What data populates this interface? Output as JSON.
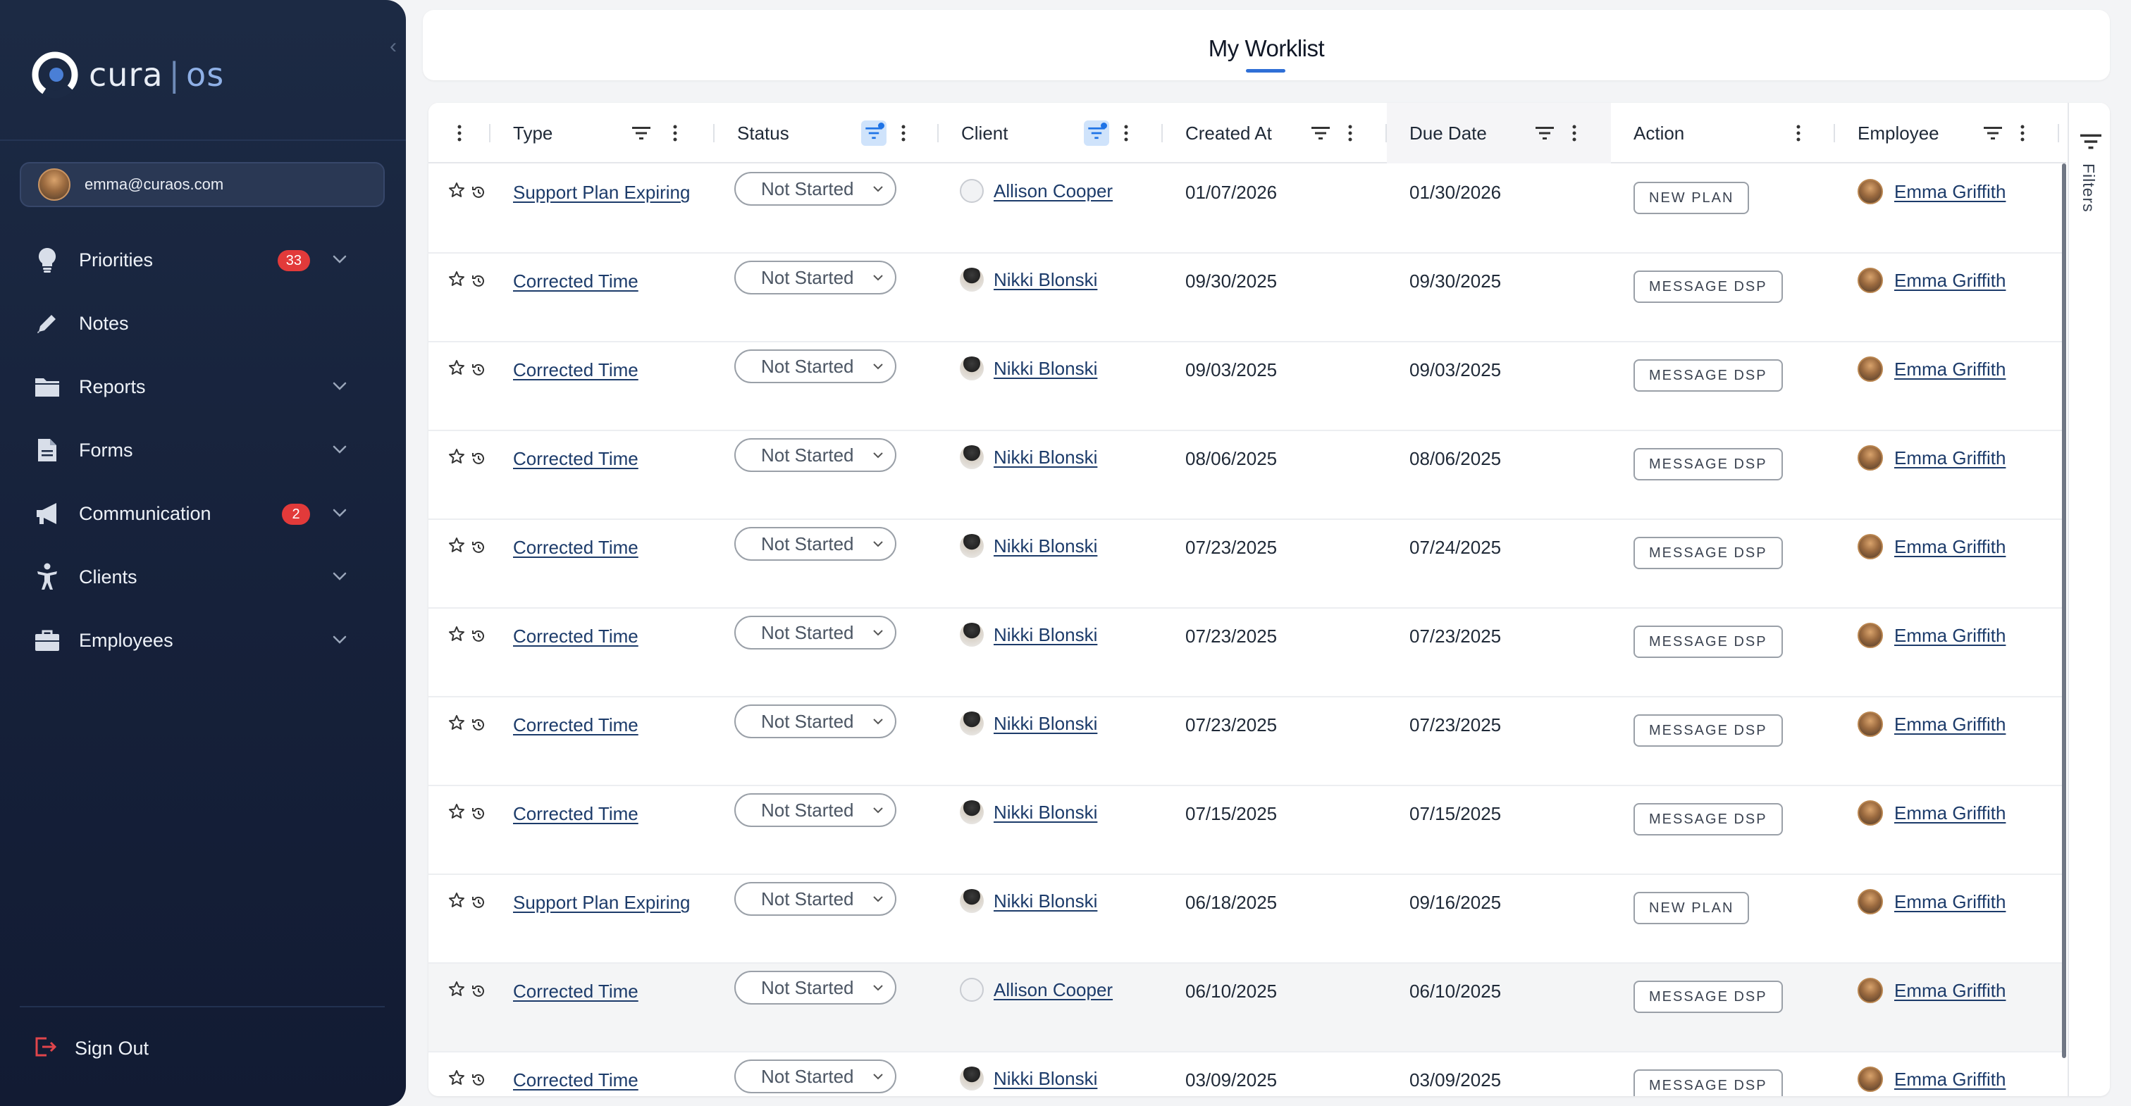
{
  "app": {
    "logo_text": "cura",
    "logo_sep": "|",
    "logo_os": "os",
    "user_email": "emma@curaos.com"
  },
  "nav": {
    "items": [
      {
        "label": "Priorities",
        "icon": "lightbulb-icon",
        "badge": "33",
        "expandable": true
      },
      {
        "label": "Notes",
        "icon": "pencil-icon",
        "badge": "",
        "expandable": false
      },
      {
        "label": "Reports",
        "icon": "folder-icon",
        "badge": "",
        "expandable": true
      },
      {
        "label": "Forms",
        "icon": "document-icon",
        "badge": "",
        "expandable": true
      },
      {
        "label": "Communication",
        "icon": "megaphone-icon",
        "badge": "2",
        "expandable": true
      },
      {
        "label": "Clients",
        "icon": "person-icon",
        "badge": "",
        "expandable": true
      },
      {
        "label": "Employees",
        "icon": "briefcase-icon",
        "badge": "",
        "expandable": true
      }
    ],
    "signout_label": "Sign Out"
  },
  "header": {
    "title": "My Worklist"
  },
  "table": {
    "columns": [
      {
        "label": "",
        "key": "select"
      },
      {
        "label": "Type",
        "filter": true,
        "filter_active": false
      },
      {
        "label": "Status",
        "filter": true,
        "filter_active": true
      },
      {
        "label": "Client",
        "filter": true,
        "filter_active": true
      },
      {
        "label": "Created At",
        "filter": true,
        "filter_active": false
      },
      {
        "label": "Due Date",
        "filter": true,
        "filter_active": false
      },
      {
        "label": "Action",
        "filter": false,
        "filter_active": false
      },
      {
        "label": "Employee",
        "filter": true,
        "filter_active": false
      }
    ],
    "rows": [
      {
        "type": "Support Plan Expiring",
        "status": "Not Started",
        "client": "Allison Cooper",
        "client_avatar": "blank",
        "created": "01/07/2026",
        "due": "01/30/2026",
        "action": "NEW PLAN",
        "employee": "Emma Griffith"
      },
      {
        "type": "Corrected Time",
        "status": "Not Started",
        "client": "Nikki Blonski",
        "client_avatar": "photo",
        "created": "09/30/2025",
        "due": "09/30/2025",
        "action": "MESSAGE DSP",
        "employee": "Emma Griffith"
      },
      {
        "type": "Corrected Time",
        "status": "Not Started",
        "client": "Nikki Blonski",
        "client_avatar": "photo",
        "created": "09/03/2025",
        "due": "09/03/2025",
        "action": "MESSAGE DSP",
        "employee": "Emma Griffith"
      },
      {
        "type": "Corrected Time",
        "status": "Not Started",
        "client": "Nikki Blonski",
        "client_avatar": "photo",
        "created": "08/06/2025",
        "due": "08/06/2025",
        "action": "MESSAGE DSP",
        "employee": "Emma Griffith"
      },
      {
        "type": "Corrected Time",
        "status": "Not Started",
        "client": "Nikki Blonski",
        "client_avatar": "photo",
        "created": "07/23/2025",
        "due": "07/24/2025",
        "action": "MESSAGE DSP",
        "employee": "Emma Griffith"
      },
      {
        "type": "Corrected Time",
        "status": "Not Started",
        "client": "Nikki Blonski",
        "client_avatar": "photo",
        "created": "07/23/2025",
        "due": "07/23/2025",
        "action": "MESSAGE DSP",
        "employee": "Emma Griffith"
      },
      {
        "type": "Corrected Time",
        "status": "Not Started",
        "client": "Nikki Blonski",
        "client_avatar": "photo",
        "created": "07/23/2025",
        "due": "07/23/2025",
        "action": "MESSAGE DSP",
        "employee": "Emma Griffith"
      },
      {
        "type": "Corrected Time",
        "status": "Not Started",
        "client": "Nikki Blonski",
        "client_avatar": "photo",
        "created": "07/15/2025",
        "due": "07/15/2025",
        "action": "MESSAGE DSP",
        "employee": "Emma Griffith"
      },
      {
        "type": "Support Plan Expiring",
        "status": "Not Started",
        "client": "Nikki Blonski",
        "client_avatar": "photo",
        "created": "06/18/2025",
        "due": "09/16/2025",
        "action": "NEW PLAN",
        "employee": "Emma Griffith"
      },
      {
        "type": "Corrected Time",
        "status": "Not Started",
        "client": "Allison Cooper",
        "client_avatar": "blank",
        "created": "06/10/2025",
        "due": "06/10/2025",
        "action": "MESSAGE DSP",
        "employee": "Emma Griffith",
        "hover": true
      },
      {
        "type": "Corrected Time",
        "status": "Not Started",
        "client": "Nikki Blonski",
        "client_avatar": "photo",
        "created": "03/09/2025",
        "due": "03/09/2025",
        "action": "MESSAGE DSP",
        "employee": "Emma Griffith"
      }
    ]
  },
  "filters_rail": {
    "label": "Filters"
  },
  "colors": {
    "sidebar_bg": "#1c2a44",
    "badge_red": "#e23a3a",
    "accent_blue": "#2f6fd6",
    "link": "#1c3b6a"
  }
}
